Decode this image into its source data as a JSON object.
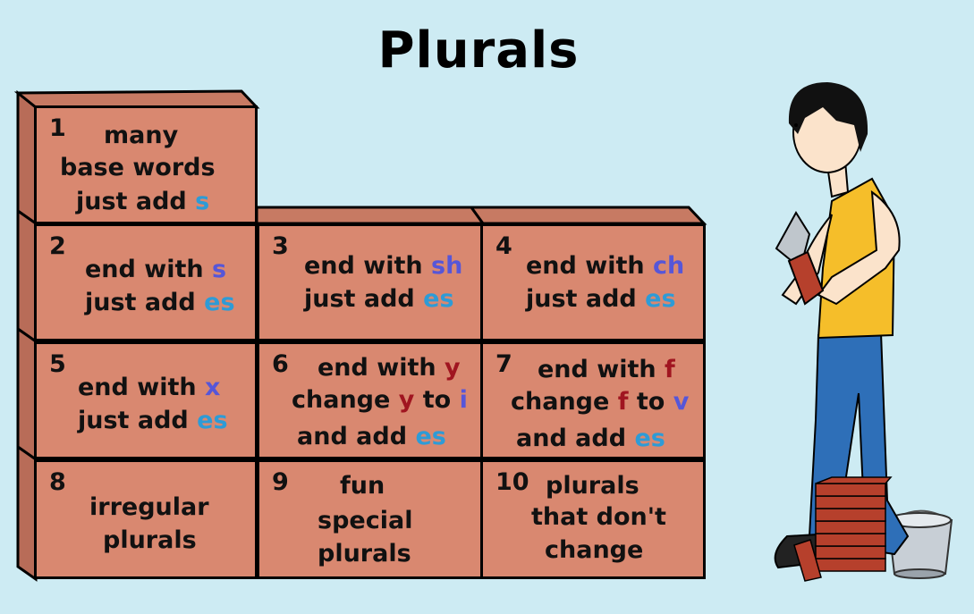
{
  "title": "Plurals",
  "bricks": [
    {
      "num": "1",
      "lines": [
        [
          "many"
        ],
        [
          "base words"
        ],
        [
          "just add ",
          {
            "t": "s",
            "c": "blue"
          }
        ]
      ]
    },
    {
      "num": "2",
      "lines": [
        [
          "end with ",
          {
            "t": "s",
            "c": "purple"
          }
        ],
        [
          "just add ",
          {
            "t": "es",
            "c": "blue"
          }
        ]
      ]
    },
    {
      "num": "3",
      "lines": [
        [
          "end with ",
          {
            "t": "sh",
            "c": "purple"
          }
        ],
        [
          "just add ",
          {
            "t": "es",
            "c": "blue"
          }
        ]
      ]
    },
    {
      "num": "4",
      "lines": [
        [
          "end with ",
          {
            "t": "ch",
            "c": "purple"
          }
        ],
        [
          "just add ",
          {
            "t": "es",
            "c": "blue"
          }
        ]
      ]
    },
    {
      "num": "5",
      "lines": [
        [
          "end with ",
          {
            "t": "x",
            "c": "purple"
          }
        ],
        [
          "just add ",
          {
            "t": "es",
            "c": "blue"
          }
        ]
      ]
    },
    {
      "num": "6",
      "lines": [
        [
          "end with ",
          {
            "t": "y",
            "c": "red"
          }
        ],
        [
          "change ",
          {
            "t": "y",
            "c": "red"
          },
          " to ",
          {
            "t": "i",
            "c": "purple"
          }
        ],
        [
          "and add ",
          {
            "t": "es",
            "c": "blue"
          }
        ]
      ]
    },
    {
      "num": "7",
      "lines": [
        [
          "end with ",
          {
            "t": "f",
            "c": "red"
          }
        ],
        [
          "change ",
          {
            "t": "f",
            "c": "red"
          },
          " to ",
          {
            "t": "v",
            "c": "purple"
          }
        ],
        [
          "and add ",
          {
            "t": "es",
            "c": "blue"
          }
        ]
      ]
    },
    {
      "num": "8",
      "lines": [
        [
          "irregular"
        ],
        [
          "plurals"
        ]
      ]
    },
    {
      "num": "9",
      "lines": [
        [
          "fun"
        ],
        [
          "special"
        ],
        [
          "plurals"
        ]
      ]
    },
    {
      "num": "10",
      "lines": [
        [
          "plurals"
        ],
        [
          "that don't"
        ],
        [
          "change"
        ]
      ]
    }
  ],
  "colors": {
    "brick": "#d98870",
    "sky": "#cdebf3",
    "blue": "#2e9bd6",
    "purple": "#5656d8",
    "red": "#a01520"
  }
}
